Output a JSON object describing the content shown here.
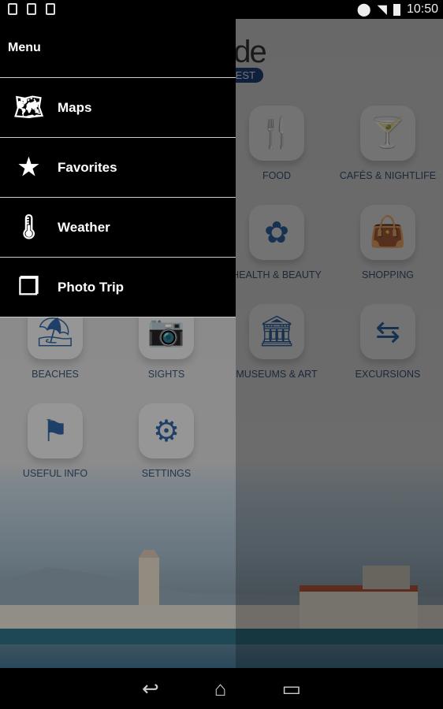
{
  "status_bar": {
    "time": "10:50",
    "icons": [
      "download-icon",
      "image-icon",
      "play-store-icon",
      "location-icon",
      "wifi-icon",
      "battery-icon"
    ]
  },
  "background": {
    "title": "Guide",
    "badge": "BEST",
    "tiles": [
      {
        "label": "FOOD",
        "icon": "fork-knife-icon",
        "glyph": "🍴"
      },
      {
        "label": "CAFÉS & NIGHTLIFE",
        "icon": "cocktail-icon",
        "glyph": "🍸"
      },
      {
        "label": "HEALTH & BEAUTY",
        "icon": "spa-stones-icon",
        "glyph": "✿"
      },
      {
        "label": "SHOPPING",
        "icon": "shopping-bag-icon",
        "glyph": "👜"
      },
      {
        "label": "BEACHES",
        "icon": "beach-umbrella-icon",
        "glyph": "⛱"
      },
      {
        "label": "SIGHTS",
        "icon": "camera-icon",
        "glyph": "📷"
      },
      {
        "label": "MUSEUMS & ART",
        "icon": "museum-icon",
        "glyph": "🏛"
      },
      {
        "label": "EXCURSIONS",
        "icon": "signpost-icon",
        "glyph": "⇆"
      },
      {
        "label": "USEFUL INFO",
        "icon": "flag-icon",
        "glyph": "⚑"
      },
      {
        "label": "SETTINGS",
        "icon": "gears-icon",
        "glyph": "⚙"
      }
    ]
  },
  "drawer": {
    "title": "Menu",
    "items": [
      {
        "label": "Maps",
        "glyph": "🗺"
      },
      {
        "label": "Favorites",
        "glyph": "★"
      },
      {
        "label": "Weather",
        "glyph": "🌡"
      },
      {
        "label": "Photo Trip",
        "glyph": "❐"
      }
    ]
  },
  "nav_bar": {
    "back": "↩",
    "home": "⌂",
    "recents": "▭"
  }
}
